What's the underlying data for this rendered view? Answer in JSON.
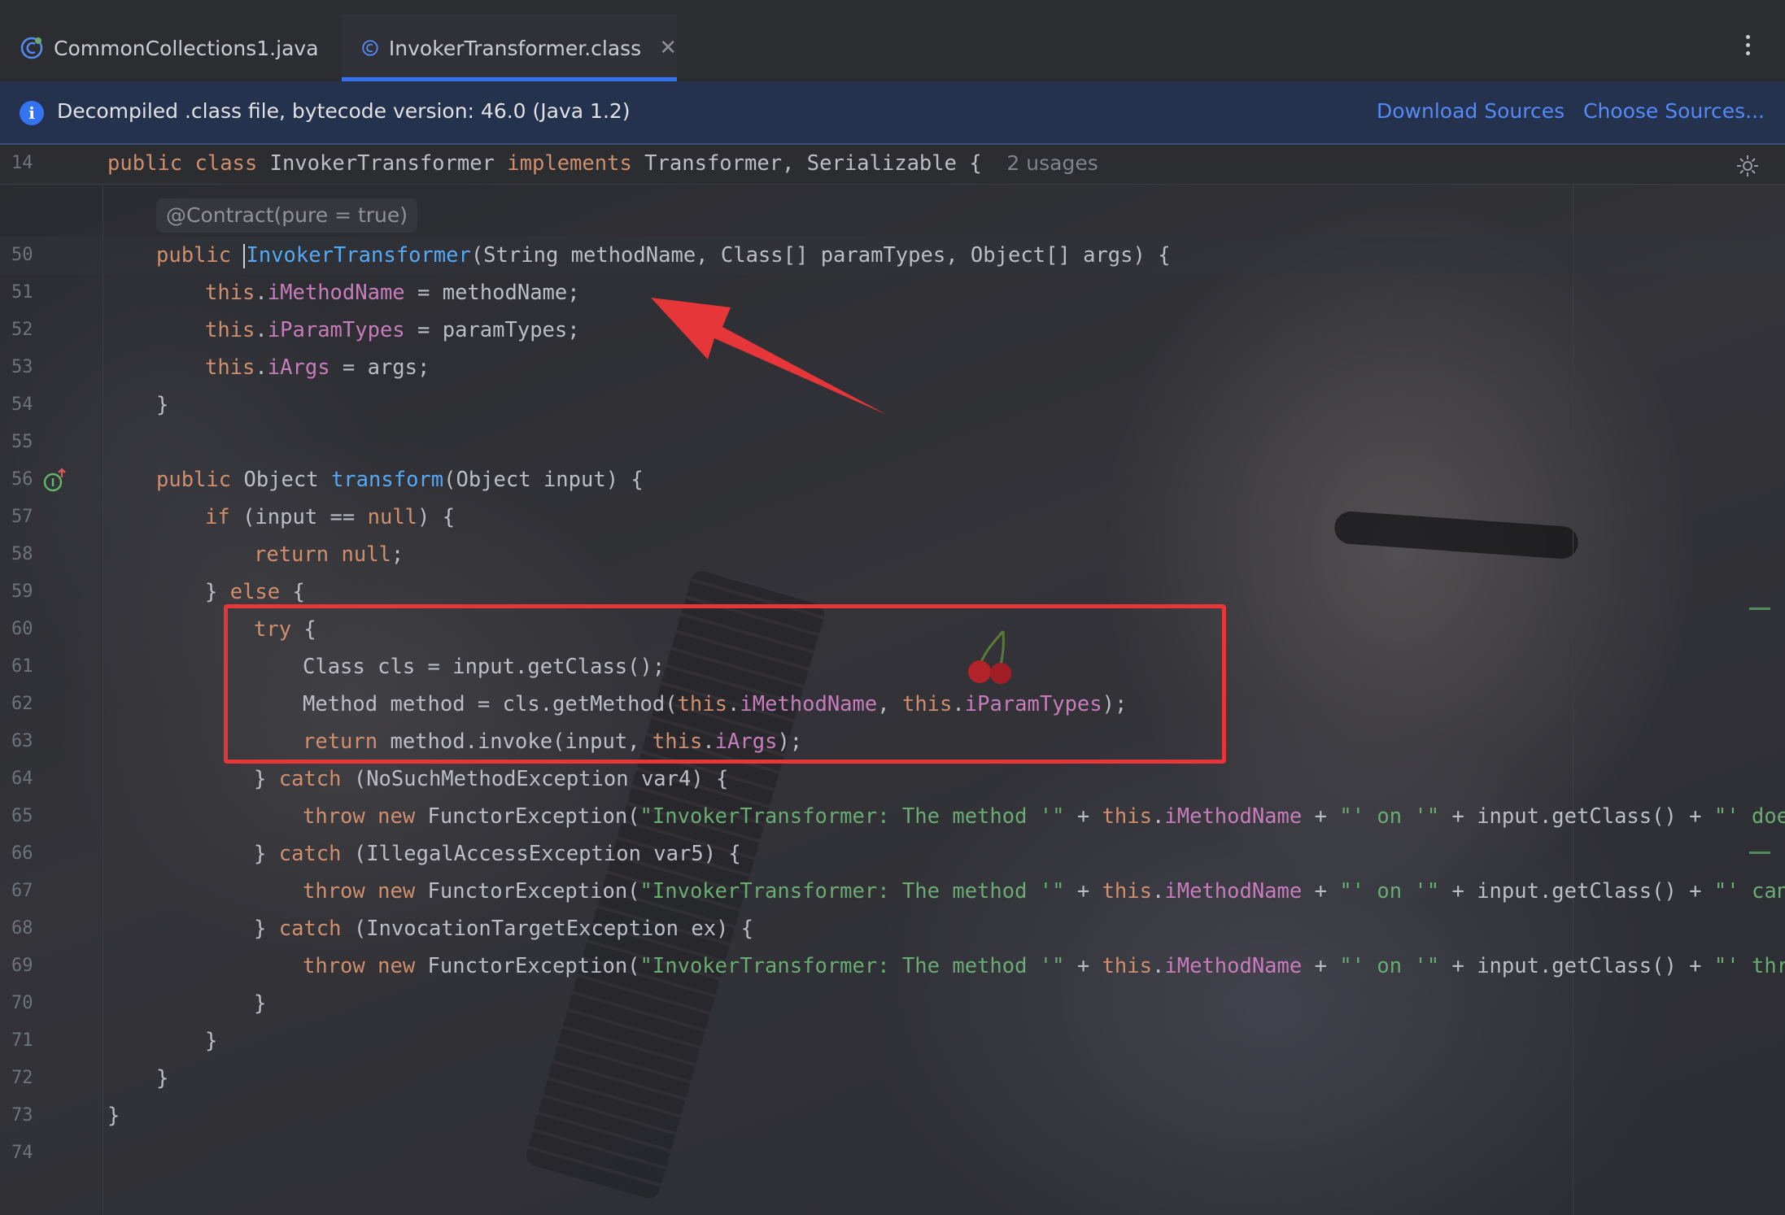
{
  "tabs": [
    {
      "label": "CommonCollections1.java",
      "active": false
    },
    {
      "label": "InvokerTransformer.class",
      "active": true
    }
  ],
  "banner": {
    "message": "Decompiled .class file, bytecode version: 46.0 (Java 1.2)",
    "download_sources": "Download Sources",
    "choose_sources": "Choose Sources..."
  },
  "editor": {
    "sticky": {
      "line_number": "14",
      "hint": "2 usages"
    },
    "annotation_hint": "@Contract(pure = true)",
    "lines": [
      {
        "n": "50"
      },
      {
        "n": "51"
      },
      {
        "n": "52"
      },
      {
        "n": "53"
      },
      {
        "n": "54"
      },
      {
        "n": "55"
      },
      {
        "n": "56"
      },
      {
        "n": "57"
      },
      {
        "n": "58"
      },
      {
        "n": "59"
      },
      {
        "n": "60"
      },
      {
        "n": "61"
      },
      {
        "n": "62"
      },
      {
        "n": "63"
      },
      {
        "n": "64"
      },
      {
        "n": "65"
      },
      {
        "n": "66"
      },
      {
        "n": "67"
      },
      {
        "n": "68"
      },
      {
        "n": "69"
      },
      {
        "n": "70"
      },
      {
        "n": "71"
      },
      {
        "n": "72"
      },
      {
        "n": "73"
      },
      {
        "n": "74"
      }
    ]
  },
  "colors": {
    "keyword": "#cf8e6d",
    "field": "#c77dbb",
    "method_declaration": "#56a8f5",
    "string": "#6aab73",
    "highlight_box": "#e6363a",
    "annotation_arrow": "#e6363a",
    "tab_accent": "#3574f0"
  },
  "icons": {
    "tab_java": "java-class-icon",
    "tab_class": "class-icon",
    "tab_close": "close-icon",
    "menu": "more-vertical-icon",
    "banner": "info-icon",
    "gutter_override": "override-method-icon",
    "reader_mode": "gear-icon"
  }
}
